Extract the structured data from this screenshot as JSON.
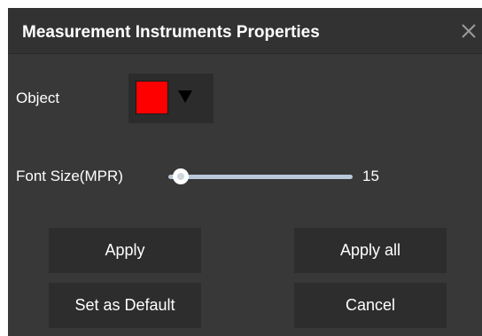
{
  "dialog": {
    "title": "Measurement Instruments Properties",
    "close_icon": "close-icon"
  },
  "object": {
    "label": "Object",
    "color": "#ff0000",
    "dropdown_icon": "triangle-down-icon"
  },
  "font_size": {
    "label": "Font Size(MPR)",
    "value": "15",
    "slider_fraction": 0.02
  },
  "buttons": {
    "apply": "Apply",
    "apply_all": "Apply all",
    "set_default": "Set as Default",
    "cancel": "Cancel"
  },
  "colors": {
    "dialog_bg": "#383838",
    "title_bg": "#323232",
    "button_bg": "#2d2d2d",
    "slider_track": "#b8c9d9",
    "text": "#ffffff"
  }
}
